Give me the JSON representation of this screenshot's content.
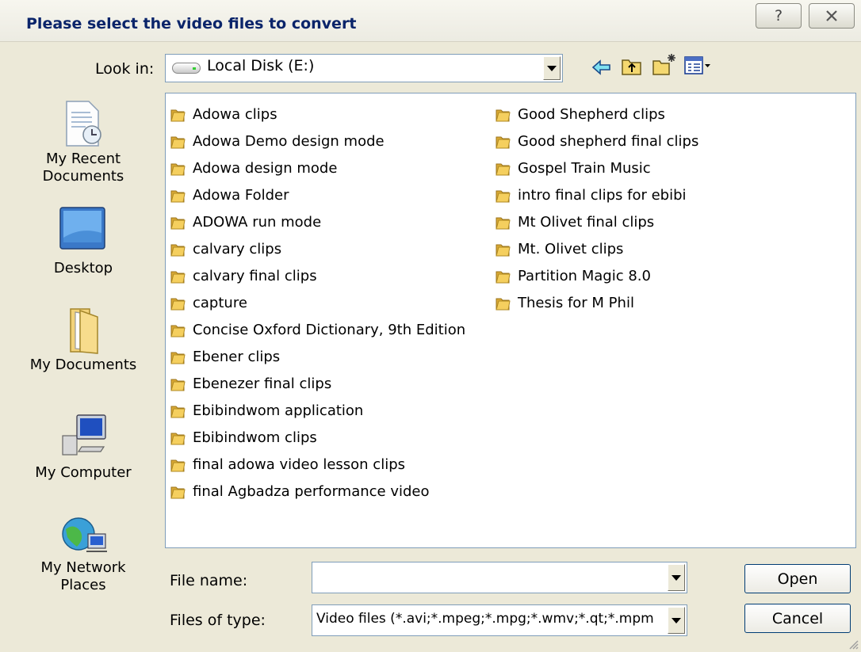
{
  "window": {
    "title": "Please select the video files to convert",
    "help_button": "?",
    "close_button": "X"
  },
  "look_in": {
    "label": "Look in:",
    "value": "Local Disk (E:)"
  },
  "toolbar": {
    "icons": [
      "back-icon",
      "up-folder-icon",
      "new-folder-icon",
      "view-menu-icon"
    ]
  },
  "places": [
    {
      "label_line1": "My Recent",
      "label_line2": "Documents",
      "icon": "recent-documents-icon"
    },
    {
      "label_line1": "Desktop",
      "label_line2": "",
      "icon": "desktop-icon"
    },
    {
      "label_line1": "My Documents",
      "label_line2": "",
      "icon": "my-documents-icon"
    },
    {
      "label_line1": "My Computer",
      "label_line2": "",
      "icon": "my-computer-icon"
    },
    {
      "label_line1": "My Network",
      "label_line2": "Places",
      "icon": "network-places-icon"
    }
  ],
  "files": {
    "column1": [
      "Adowa clips",
      "Adowa Demo design mode",
      "Adowa design mode",
      "Adowa Folder",
      "ADOWA run mode",
      "calvary clips",
      "calvary final clips",
      "capture",
      "Concise Oxford Dictionary, 9th Edition",
      "Ebener clips",
      "Ebenezer final clips",
      "Ebibindwom application",
      "Ebibindwom clips",
      "final adowa video  lesson clips",
      "final Agbadza performance video"
    ],
    "column2": [
      "Good Shepherd clips",
      "Good shepherd final clips",
      "Gospel Train Music",
      "intro final clips for ebibi",
      "Mt Olivet final clips",
      "Mt. Olivet clips",
      "Partition Magic 8.0",
      "Thesis for M Phil"
    ]
  },
  "file_name": {
    "label": "File name:",
    "value": ""
  },
  "file_type": {
    "label": "Files of type:",
    "value": "Video files (*.avi;*.mpeg;*.mpg;*.wmv;*.qt;*.mpm"
  },
  "buttons": {
    "open": "Open",
    "cancel": "Cancel"
  },
  "colors": {
    "title_text": "#0a246a",
    "folder": "#f0c24f",
    "dialog_bg": "#ece9d8",
    "field_border": "#7f9db9"
  }
}
